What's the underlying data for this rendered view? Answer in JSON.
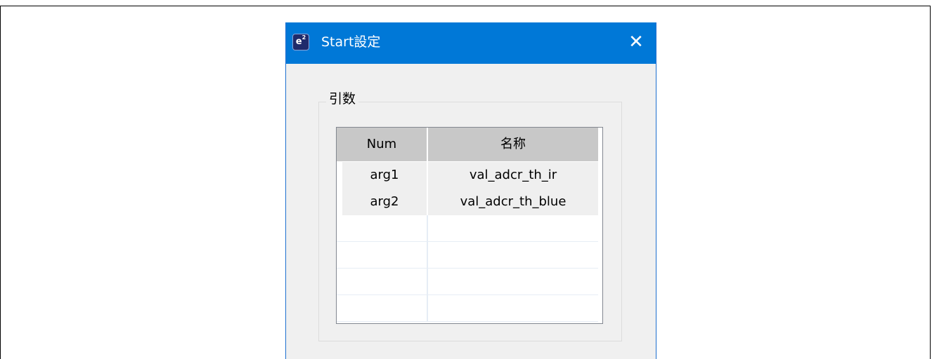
{
  "window": {
    "title": "Start設定",
    "app_icon_letter": "e",
    "app_icon_superscript": "2",
    "close_glyph": "✕"
  },
  "group": {
    "label": "引数"
  },
  "table": {
    "columns": [
      "Num",
      "名称"
    ],
    "rows": [
      [
        "arg1",
        "val_adcr_th_ir"
      ],
      [
        "arg2",
        "val_adcr_th_blue"
      ]
    ]
  },
  "colors": {
    "titlebar": "#0078d7",
    "dialog_bg": "#f0f0f0",
    "header_bg": "#c8c8c8"
  }
}
